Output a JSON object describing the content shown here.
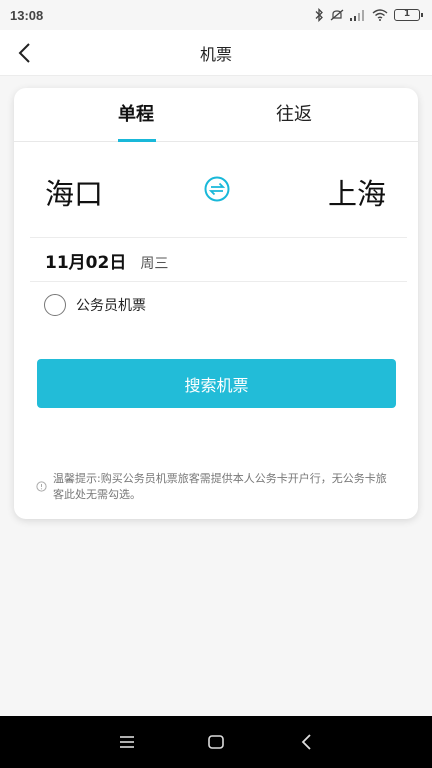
{
  "status_bar": {
    "time": "13:08",
    "battery": "1"
  },
  "header": {
    "title": "机票",
    "back_icon": "chevron-left-icon"
  },
  "tabs": [
    {
      "label": "单程",
      "active": true
    },
    {
      "label": "往返",
      "active": false
    }
  ],
  "route": {
    "from": "海口",
    "to": "上海",
    "swap_icon": "swap-icon"
  },
  "date": {
    "main": "11月02日",
    "weekday": "周三"
  },
  "civil_servant": {
    "label": "公务员机票",
    "checked": false
  },
  "search_button": {
    "label": "搜索机票"
  },
  "notice": {
    "text": "温馨提示:购买公务员机票旅客需提供本人公务卡开户行，无公务卡旅客此处无需勾选。"
  },
  "colors": {
    "accent": "#19b8d9",
    "button": "#22bcd8"
  }
}
